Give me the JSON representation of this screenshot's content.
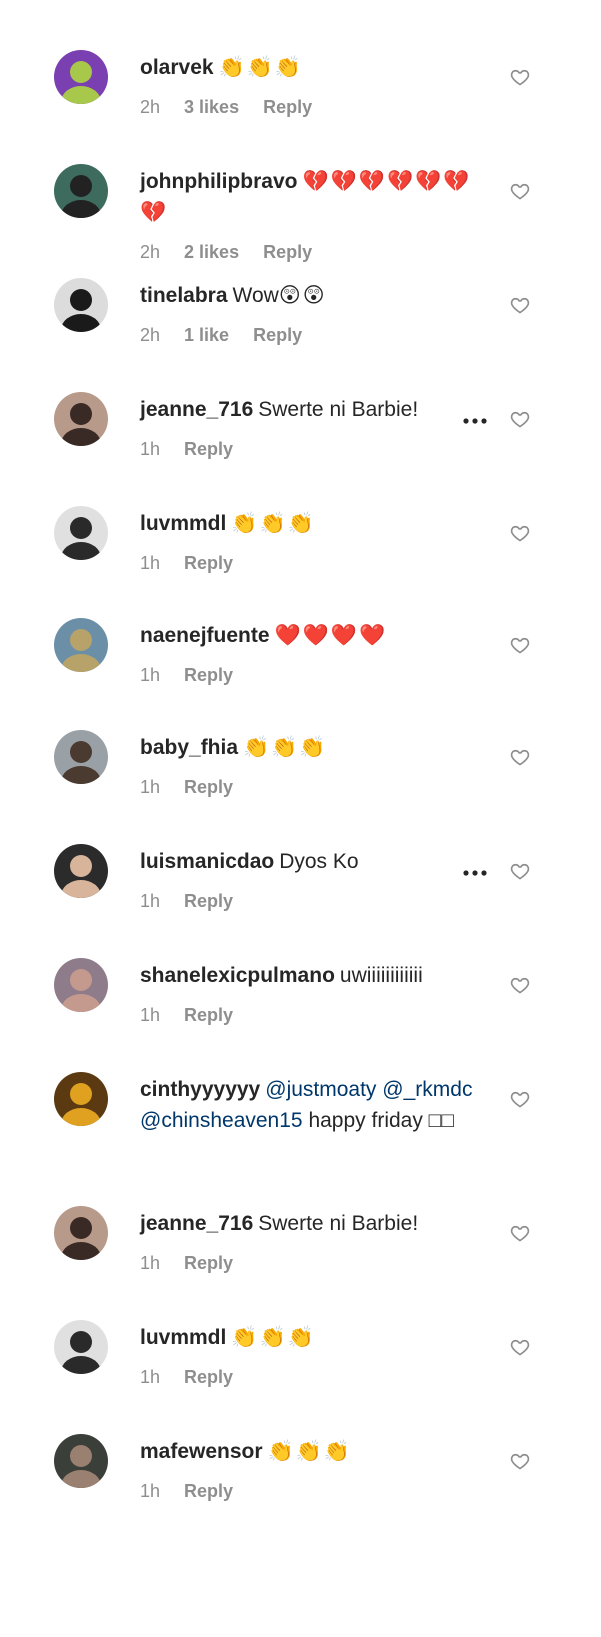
{
  "comments": [
    {
      "username": "olarvek",
      "segments": [],
      "emoji": "👏👏👏",
      "time": "2h",
      "likes": "3 likes",
      "reply": "Reply",
      "avatar_color": "#7a3fb0",
      "avatar_accent": "#a7c84a"
    },
    {
      "username": "johnphilipbravo",
      "segments": [],
      "emoji": "💔💔💔💔💔💔💔",
      "time": "2h",
      "likes": "2 likes",
      "reply": "Reply",
      "avatar_color": "#3d6b5e",
      "avatar_accent": "#222222"
    },
    {
      "username": "tinelabra",
      "segments": [
        {
          "text": "Wow",
          "mention": false
        }
      ],
      "emoji": "😲😲",
      "time": "2h",
      "likes": "1 like",
      "reply": "Reply",
      "avatar_color": "#dcdcdc",
      "avatar_accent": "#1a1a1a"
    },
    {
      "username": "jeanne_716",
      "segments": [
        {
          "text": "Swerte ni Barbie!",
          "mention": false
        }
      ],
      "emoji": "",
      "time": "1h",
      "likes": "",
      "reply": "Reply",
      "avatar_color": "#b89a8a",
      "avatar_accent": "#3a2a25",
      "more": true
    },
    {
      "username": "luvmmdl",
      "segments": [],
      "emoji": "👏👏👏",
      "time": "1h",
      "likes": "",
      "reply": "Reply",
      "avatar_color": "#e0e0e0",
      "avatar_accent": "#2a2a2a"
    },
    {
      "username": "naenejfuente",
      "segments": [],
      "emoji": "❤️❤️❤️❤️",
      "time": "1h",
      "likes": "",
      "reply": "Reply",
      "avatar_color": "#6c8fa8",
      "avatar_accent": "#b7a36a"
    },
    {
      "username": "baby_fhia",
      "segments": [],
      "emoji": "👏👏👏",
      "time": "1h",
      "likes": "",
      "reply": "Reply",
      "avatar_color": "#9aa1a6",
      "avatar_accent": "#4a3a30"
    },
    {
      "username": "luismanicdao",
      "segments": [
        {
          "text": "Dyos Ko",
          "mention": false
        }
      ],
      "emoji": "",
      "time": "1h",
      "likes": "",
      "reply": "Reply",
      "avatar_color": "#2b2b2b",
      "avatar_accent": "#d8b49a",
      "more": true
    },
    {
      "username": "shanelexicpulmano",
      "segments": [
        {
          "text": "uwiiiiiiiiiiii",
          "mention": false
        }
      ],
      "emoji": "",
      "time": "1h",
      "likes": "",
      "reply": "Reply",
      "avatar_color": "#8f7c8a",
      "avatar_accent": "#c49a8f"
    },
    {
      "username": "cinthyyyyyy",
      "segments": [
        {
          "text": "@justmoaty",
          "mention": true
        },
        {
          "text": " ",
          "mention": false
        },
        {
          "text": "@_rkmdc",
          "mention": true
        },
        {
          "text": " ",
          "mention": false
        },
        {
          "text": "@chinsheaven15",
          "mention": true
        },
        {
          "text": " happy friday □□",
          "mention": false
        }
      ],
      "emoji": "",
      "time": "",
      "likes": "",
      "reply": "",
      "avatar_color": "#5b3a12",
      "avatar_accent": "#e0a020"
    },
    {
      "username": "jeanne_716",
      "segments": [
        {
          "text": "Swerte ni Barbie!",
          "mention": false
        }
      ],
      "emoji": "",
      "time": "1h",
      "likes": "",
      "reply": "Reply",
      "avatar_color": "#b89a8a",
      "avatar_accent": "#3a2a25"
    },
    {
      "username": "luvmmdl",
      "segments": [],
      "emoji": "👏👏👏",
      "time": "1h",
      "likes": "",
      "reply": "Reply",
      "avatar_color": "#e0e0e0",
      "avatar_accent": "#2a2a2a"
    },
    {
      "username": "mafewensor",
      "segments": [],
      "emoji": "👏👏👏",
      "time": "1h",
      "likes": "",
      "reply": "Reply",
      "avatar_color": "#3a3f3a",
      "avatar_accent": "#9a8070"
    }
  ],
  "icons": {
    "like": "heart-outline-icon",
    "more": "more-options-icon"
  }
}
